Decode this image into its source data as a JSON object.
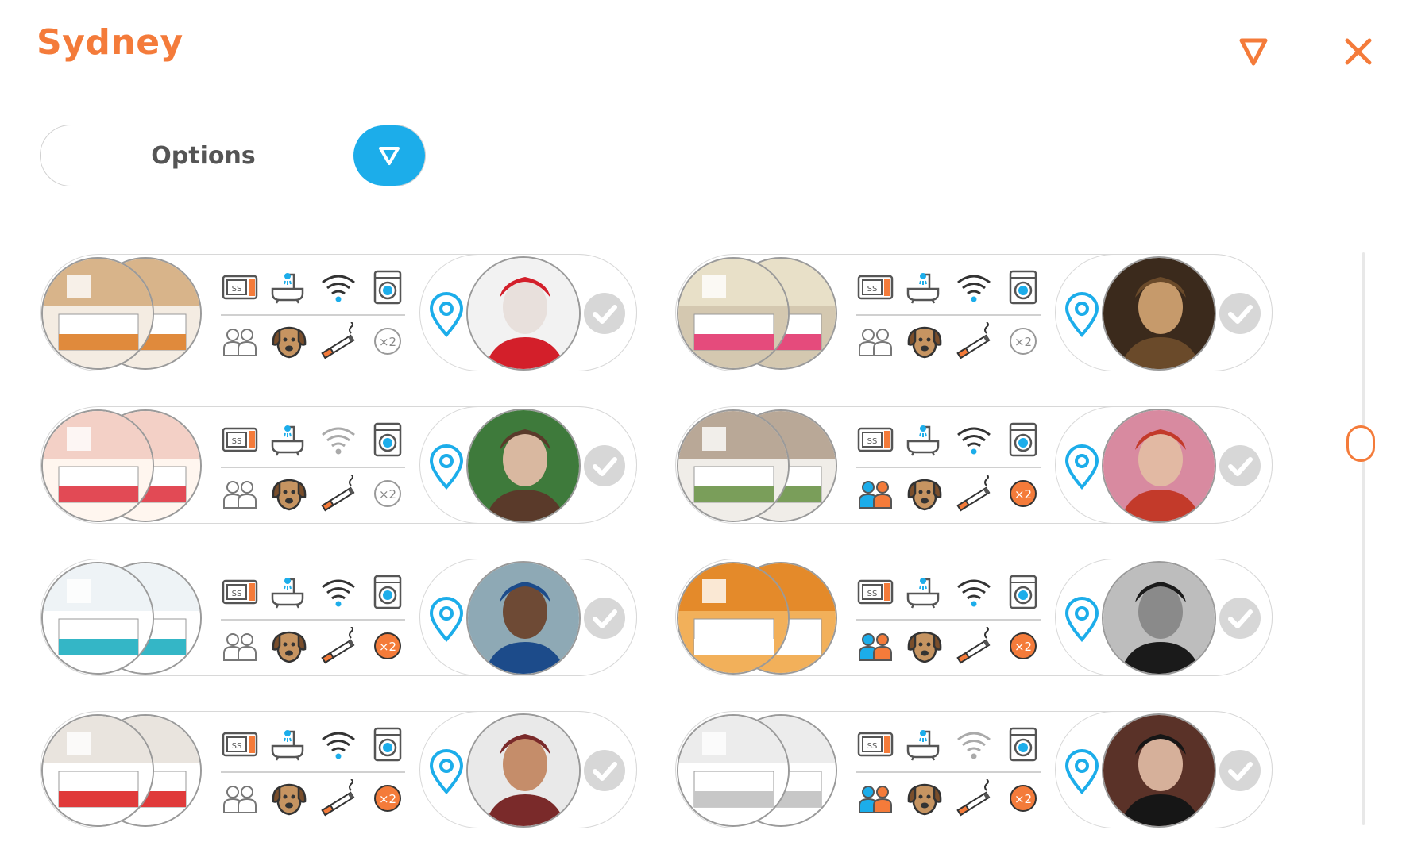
{
  "header": {
    "title": "Sydney",
    "filter_icon": "filter-triangle-icon",
    "close_icon": "close-icon"
  },
  "options": {
    "label": "Options",
    "toggle_icon": "chevron-down-triangle-icon"
  },
  "colors": {
    "accent": "#f47b3a",
    "blue": "#1cadea",
    "check": "#d7d7d7"
  },
  "listings": [
    {
      "room": "room-attic-bedroom",
      "host": "host-woman-white-hair",
      "wifi": true,
      "people2": false,
      "badge_x2": false
    },
    {
      "room": "room-striped-bed",
      "host": "host-man-beard",
      "wifi": true,
      "people2": false,
      "badge_x2": false
    },
    {
      "room": "room-pink-bedroom",
      "host": "host-woman-leaves",
      "wifi": false,
      "people2": false,
      "badge_x2": false
    },
    {
      "room": "room-art-bedroom",
      "host": "host-woman-red-hair",
      "wifi": true,
      "people2": true,
      "badge_x2": true
    },
    {
      "room": "room-blue-bed",
      "host": "host-woman-earrings",
      "wifi": true,
      "people2": false,
      "badge_x2": true
    },
    {
      "room": "room-orange-bedroom",
      "host": "host-man-bw",
      "wifi": true,
      "people2": true,
      "badge_x2": true
    },
    {
      "room": "room-red-pillows",
      "host": "host-man-glasses",
      "wifi": true,
      "people2": false,
      "badge_x2": true
    },
    {
      "room": "room-white-twin",
      "host": "host-man-hoodie",
      "wifi": false,
      "people2": true,
      "badge_x2": true
    }
  ],
  "scroll": {
    "position": 0.0
  }
}
